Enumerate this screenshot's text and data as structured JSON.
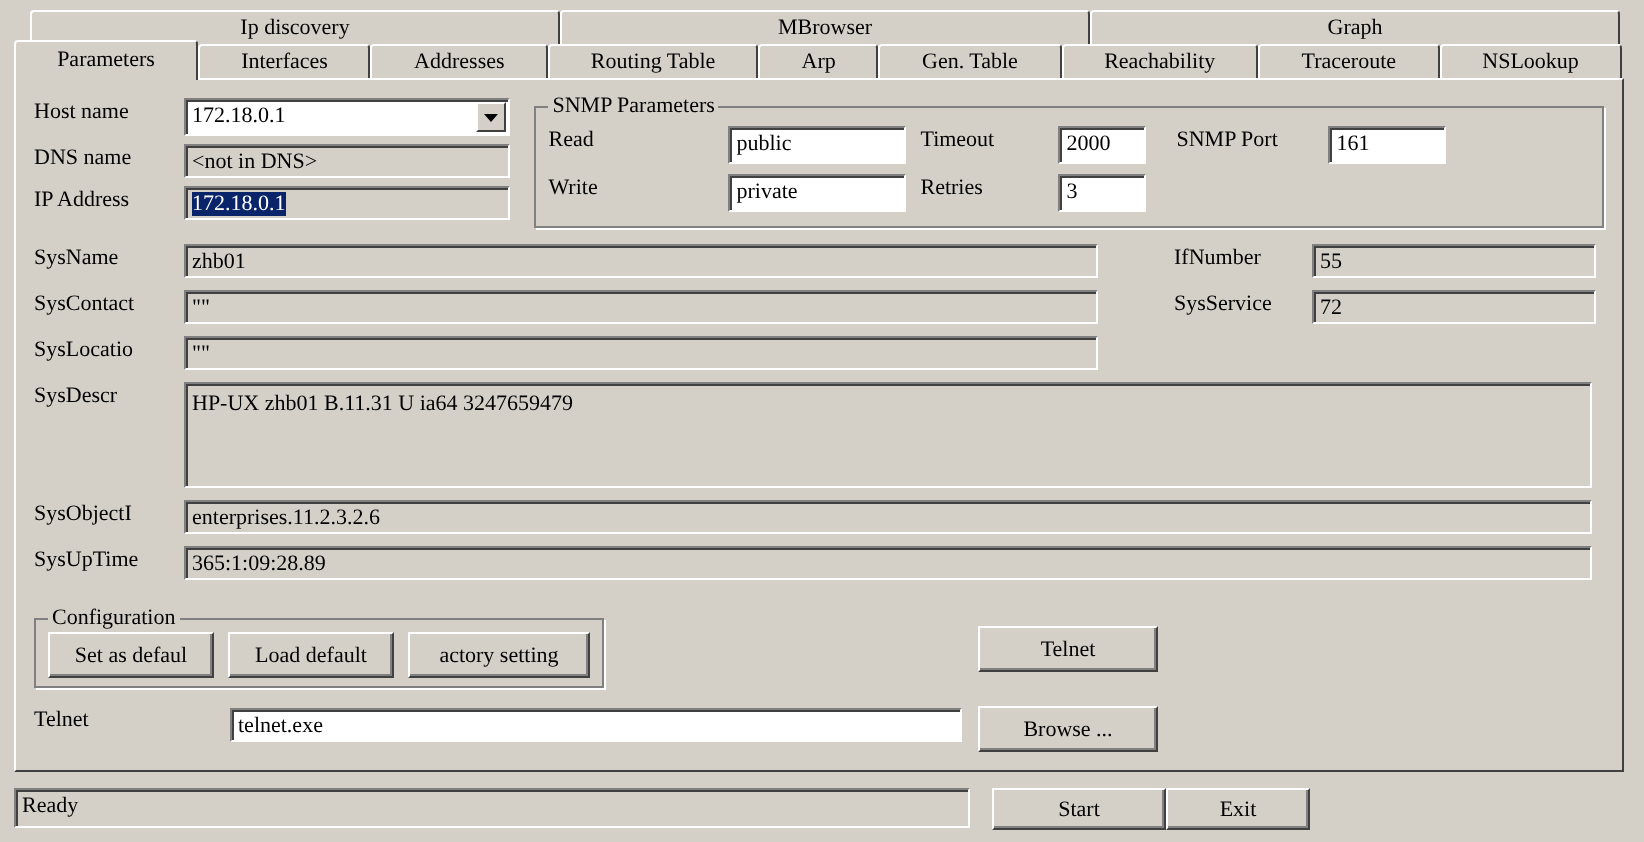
{
  "tab_rows": [
    [
      {
        "label": "Ip discovery",
        "selected": false
      },
      {
        "label": "MBrowser",
        "selected": false
      },
      {
        "label": "Graph",
        "selected": false
      }
    ],
    [
      {
        "label": "Parameters",
        "selected": true
      },
      {
        "label": "Interfaces",
        "selected": false
      },
      {
        "label": "Addresses",
        "selected": false
      },
      {
        "label": "Routing Table",
        "selected": false
      },
      {
        "label": "Arp",
        "selected": false
      },
      {
        "label": "Gen. Table",
        "selected": false
      },
      {
        "label": "Reachability",
        "selected": false
      },
      {
        "label": "Traceroute",
        "selected": false
      },
      {
        "label": "NSLookup",
        "selected": false
      }
    ]
  ],
  "address": [
    {
      "label": "Host name",
      "value": "172.18.0.1",
      "kind": "combo",
      "readonly": false
    },
    {
      "label": "DNS name",
      "value": "<not in DNS>",
      "kind": "text",
      "readonly": true
    },
    {
      "label": "IP Address",
      "value": "172.18.0.1",
      "kind": "text",
      "readonly": true,
      "highlighted": true
    }
  ],
  "snmp": {
    "title": "SNMP Parameters",
    "rows": [
      [
        {
          "label": "Read",
          "value": "public",
          "readonly": false
        },
        {
          "label": "Timeout",
          "value": "2000",
          "readonly": false
        },
        {
          "label": "SNMP Port",
          "value": "161",
          "readonly": false
        }
      ],
      [
        {
          "label": "Write",
          "value": "private",
          "readonly": false
        },
        {
          "label": "Retries",
          "value": "3",
          "readonly": false
        }
      ]
    ]
  },
  "system_left": [
    {
      "label": "SysName",
      "value": "zhb01",
      "readonly": true
    },
    {
      "label": "SysContact",
      "value": "\"\"",
      "readonly": true
    },
    {
      "label": "SysLocatio",
      "value": "\"\"",
      "readonly": true
    }
  ],
  "system_right": [
    {
      "label": "IfNumber",
      "value": "55",
      "readonly": true
    },
    {
      "label": "SysService",
      "value": "72",
      "readonly": true
    }
  ],
  "system_wide": [
    {
      "label": "SysDescr",
      "value": "HP-UX zhb01 B.11.31 U ia64 3247659479",
      "readonly": true,
      "kind": "multiline"
    },
    {
      "label": "SysObjectI",
      "value": "enterprises.11.2.3.2.6",
      "readonly": true,
      "kind": "text"
    },
    {
      "label": "SysUpTime",
      "value": "365:1:09:28.89",
      "readonly": true,
      "kind": "text"
    }
  ],
  "configuration": {
    "title": "Configuration",
    "buttons": [
      "Set as defaul",
      "Load default",
      "actory setting"
    ]
  },
  "telnet_button": "Telnet",
  "telnet": {
    "label": "Telnet",
    "value": "telnet.exe",
    "readonly": false
  },
  "browse_button": "Browse ...",
  "status": "Ready",
  "buttons": [
    "Start",
    "Exit"
  ]
}
